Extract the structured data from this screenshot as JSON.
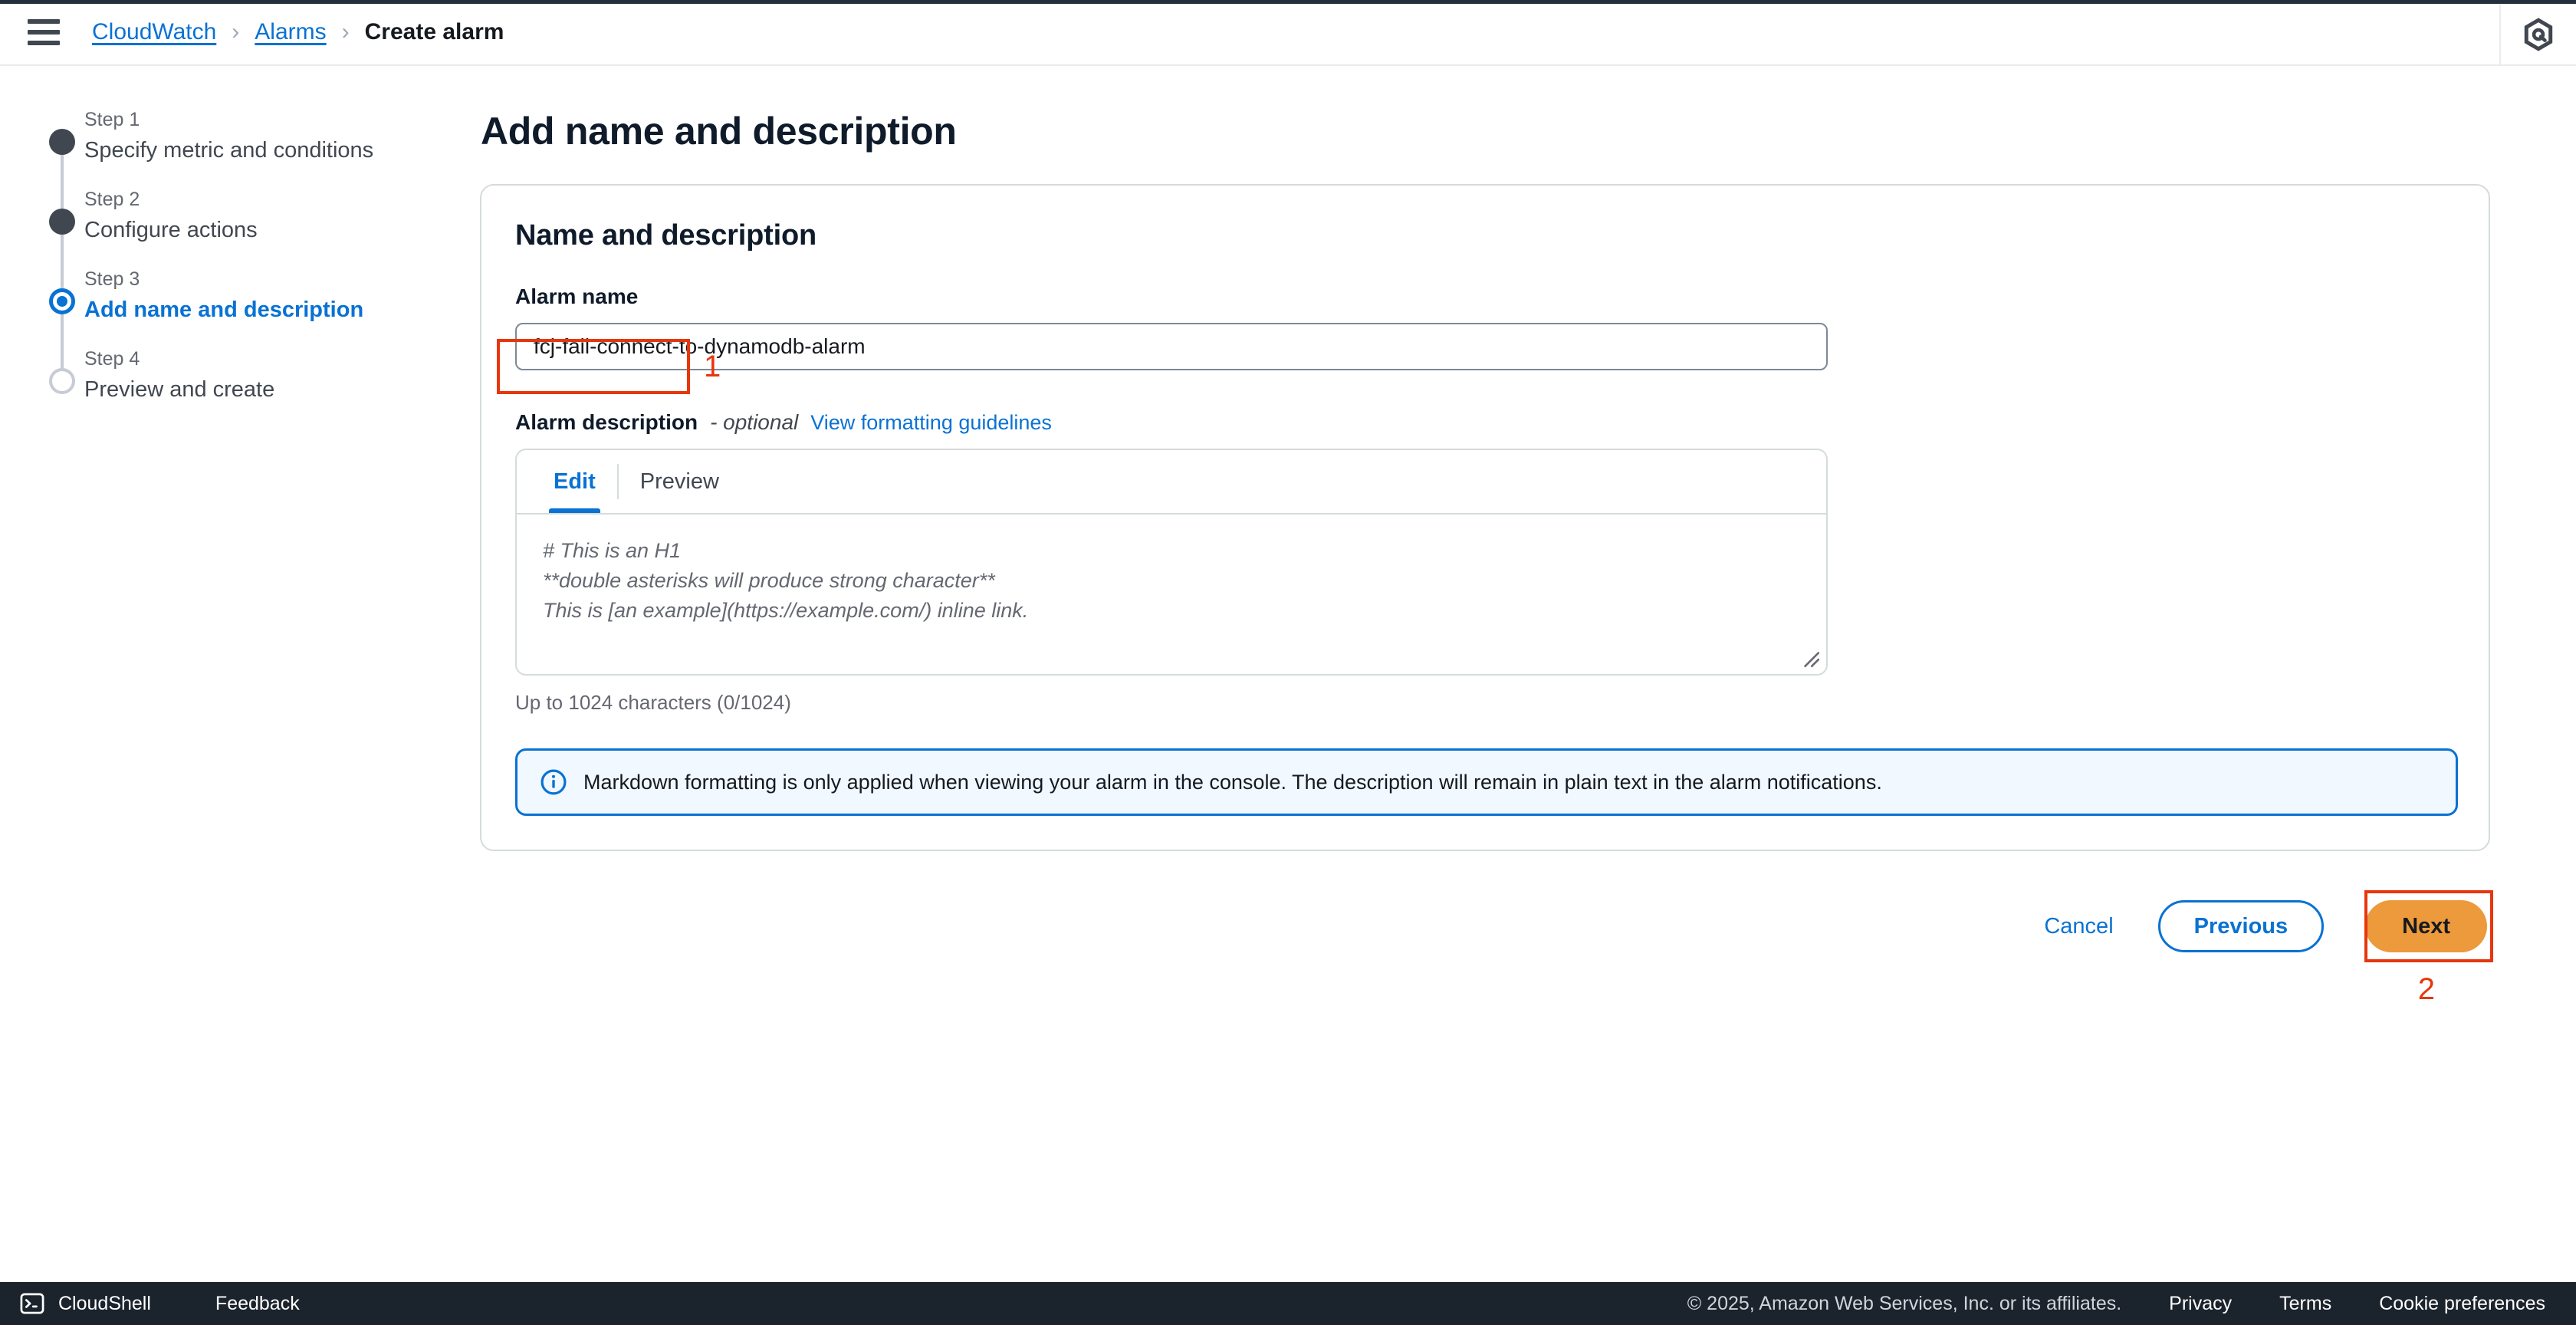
{
  "header": {
    "menu_icon": "hamburger-menu-icon",
    "breadcrumb": [
      {
        "label": "CloudWatch",
        "type": "link"
      },
      {
        "label": "Alarms",
        "type": "link"
      },
      {
        "label": "Create alarm",
        "type": "current"
      }
    ],
    "separator": "›",
    "assistant_icon": "amazon-q-hexagon-icon"
  },
  "steps": [
    {
      "number": "Step 1",
      "label": "Specify metric and conditions",
      "state": "done"
    },
    {
      "number": "Step 2",
      "label": "Configure actions",
      "state": "done"
    },
    {
      "number": "Step 3",
      "label": "Add name and description",
      "state": "active"
    },
    {
      "number": "Step 4",
      "label": "Preview and create",
      "state": "pending"
    }
  ],
  "main": {
    "page_title": "Add name and description",
    "card_title": "Name and description",
    "alarm_name": {
      "label": "Alarm name",
      "value": "fcj-fail-connect-to-dynamodb-alarm"
    },
    "description": {
      "label": "Alarm description",
      "optional_suffix": "- optional",
      "guidelines_link": "View formatting guidelines",
      "tabs": [
        {
          "label": "Edit",
          "active": true
        },
        {
          "label": "Preview",
          "active": false
        }
      ],
      "placeholder_lines": [
        "# This is an H1",
        "**double asterisks will produce strong character**",
        "This is [an example](https://example.com/) inline link."
      ],
      "char_count": "Up to 1024 characters (0/1024)"
    },
    "alert": {
      "icon": "info-circle-icon",
      "text": "Markdown formatting is only applied when viewing your alarm in the console. The description will remain in plain text in the alarm notifications."
    },
    "actions": {
      "cancel": "Cancel",
      "previous": "Previous",
      "next": "Next"
    }
  },
  "annotations": [
    {
      "number": "1",
      "target": "alarm-name-input"
    },
    {
      "number": "2",
      "target": "next-button"
    }
  ],
  "statusbar": {
    "cloudshell": "CloudShell",
    "cloudshell_icon": "terminal-icon",
    "feedback": "Feedback",
    "copyright": "© 2025, Amazon Web Services, Inc. or its affiliates.",
    "links": [
      "Privacy",
      "Terms",
      "Cookie preferences"
    ]
  },
  "colors": {
    "link_blue": "#0972d3",
    "primary_orange": "#ec9a3c",
    "annotation_red": "#e8360c",
    "alert_bg": "#f1f8ff",
    "statusbar_bg": "#1b232d"
  }
}
